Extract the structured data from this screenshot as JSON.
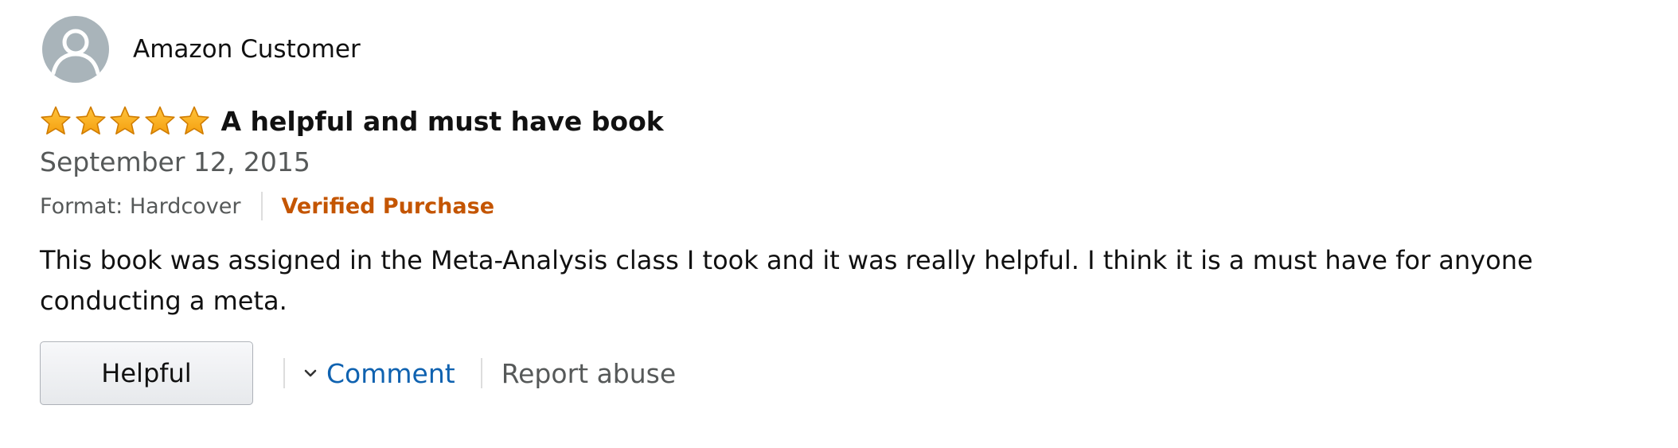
{
  "review": {
    "profile": {
      "name": "Amazon Customer",
      "avatar_icon": "default-user-silhouette-icon"
    },
    "rating": {
      "stars": 5,
      "max_stars": 5,
      "star_icon": "star-icon",
      "star_color": "#ffa41c"
    },
    "title": "A helpful and must have book",
    "date": "September 12, 2015",
    "format": "Format: Hardcover",
    "verified_label": "Verified Purchase",
    "body_lines": [
      "This book was assigned in the Meta-Analysis class I took and it was really helpful. I think it is a must have for anyone",
      "conducting a meta."
    ],
    "actions": {
      "helpful_label": "Helpful",
      "comment_label": "Comment",
      "comment_icon": "chevron-down-icon",
      "report_label": "Report abuse"
    },
    "colors": {
      "verified": "#c45500",
      "link": "#0f62b0",
      "secondary_text": "#565959"
    }
  }
}
